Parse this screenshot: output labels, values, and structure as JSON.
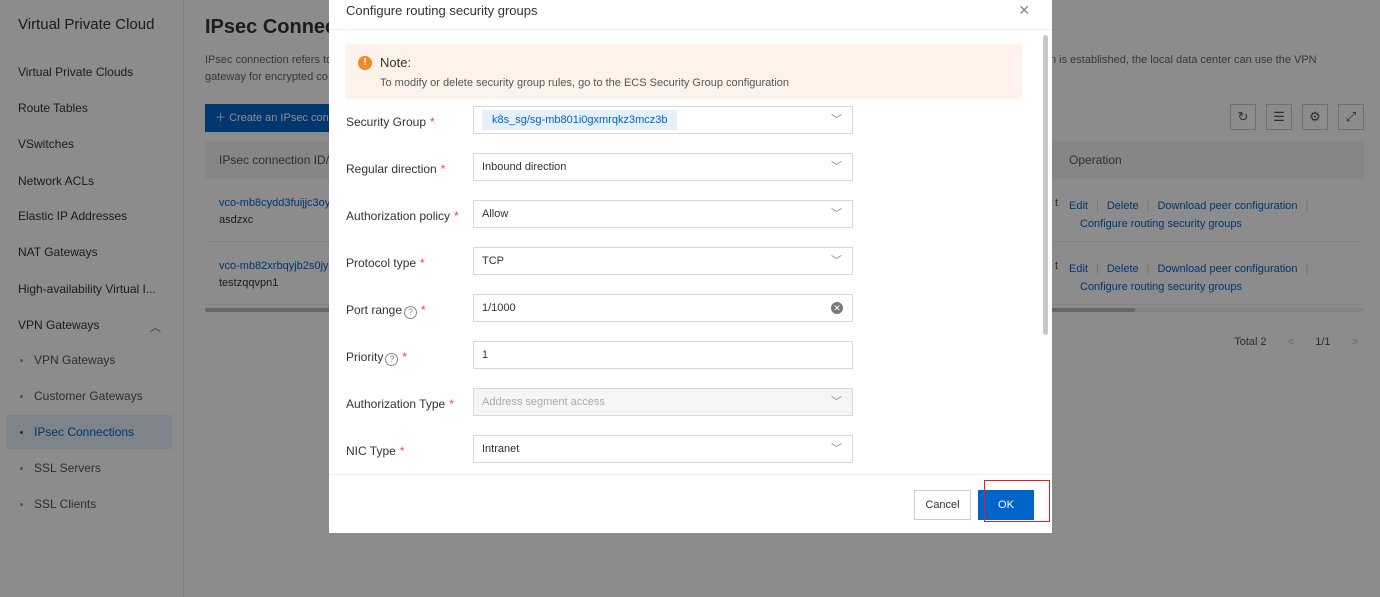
{
  "sidebar": {
    "title": "Virtual Private Cloud",
    "items": [
      {
        "label": "Virtual Private Clouds"
      },
      {
        "label": "Route Tables"
      },
      {
        "label": "VSwitches"
      },
      {
        "label": "Network ACLs"
      },
      {
        "label": "Elastic IP Addresses"
      },
      {
        "label": "NAT Gateways"
      },
      {
        "label": "High-availability Virtual I..."
      },
      {
        "label": "VPN Gateways"
      }
    ],
    "sub_items": [
      {
        "label": "VPN Gateways"
      },
      {
        "label": "Customer Gateways"
      },
      {
        "label": "IPsec Connections"
      },
      {
        "label": "SSL Servers"
      },
      {
        "label": "SSL Clients"
      }
    ]
  },
  "main": {
    "title": "IPsec Connec",
    "desc_left_1": "IPsec connection refers to",
    "desc_left_2": "gateway for encrypted co",
    "desc_right": "n is established, the local data center can use the VPN",
    "create_label": "Create an IPsec con",
    "col_id": "IPsec connection ID/na",
    "col_ops": "Operation",
    "rows": [
      {
        "id": "vco-mb8cydd3fuijjc3oy",
        "name": "asdzxc",
        "tail": "t"
      },
      {
        "id": "vco-mb82xrbqyjb2s0jy",
        "name": "testzqqvpn1",
        "tail": "t"
      }
    ],
    "ops": {
      "edit": "Edit",
      "delete": "Delete",
      "download": "Download peer configuration",
      "configure": "Configure routing security groups"
    },
    "pager": {
      "total": "Total 2",
      "page": "1/1"
    }
  },
  "dialog": {
    "title": "Configure routing security groups",
    "note_title": "Note:",
    "note_text": "To modify or delete security group rules, go to the ECS Security Group configuration",
    "fields": {
      "security_group": {
        "label": "Security Group",
        "value": "k8s_sg/sg-mb801i0gxmrqkz3mcz3b"
      },
      "direction": {
        "label": "Regular direction",
        "value": "Inbound direction"
      },
      "policy": {
        "label": "Authorization policy",
        "value": "Allow"
      },
      "protocol": {
        "label": "Protocol type",
        "value": "TCP"
      },
      "port": {
        "label": "Port range",
        "value": "1/1000"
      },
      "priority": {
        "label": "Priority",
        "value": "1"
      },
      "auth_type": {
        "label": "Authorization Type",
        "placeholder": "Address segment access"
      },
      "nic": {
        "label": "NIC Type",
        "value": "Intranet"
      }
    },
    "cancel_label": "Cancel",
    "ok_label": "OK"
  }
}
